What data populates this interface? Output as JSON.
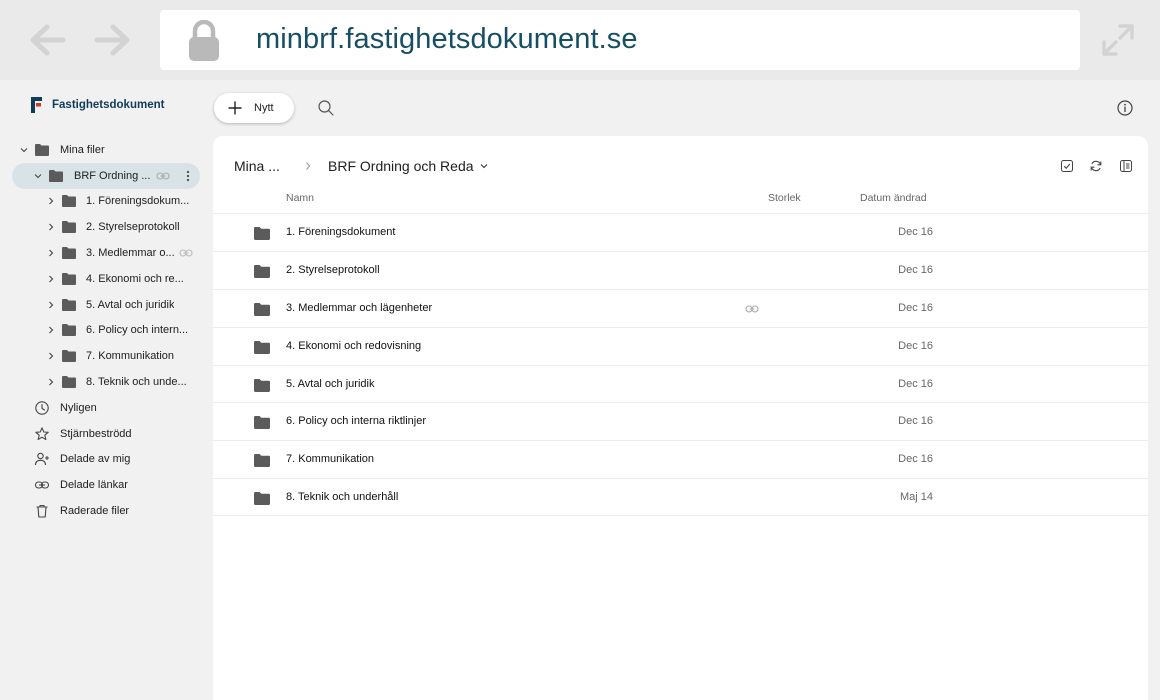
{
  "browser": {
    "url": "minbrf.fastighetsdokument.se"
  },
  "brand": {
    "name": "Fastighetsdokument",
    "accent": "#0f3b57",
    "mark_red": "#d9342b"
  },
  "sidebar": {
    "tree": [
      {
        "label": "Mina filer",
        "level": 0,
        "expanded": true
      },
      {
        "label": "BRF Ordning ...",
        "level": 1,
        "expanded": true,
        "selected": true,
        "shared_link": true
      },
      {
        "label": "1. Föreningsdokum...",
        "level": 2
      },
      {
        "label": "2. Styrelseprotokoll",
        "level": 2
      },
      {
        "label": "3. Medlemmar o...",
        "level": 2,
        "shared_link": true
      },
      {
        "label": "4. Ekonomi och re...",
        "level": 2
      },
      {
        "label": "5. Avtal och juridik",
        "level": 2
      },
      {
        "label": "6. Policy och intern...",
        "level": 2
      },
      {
        "label": "7. Kommunikation",
        "level": 2
      },
      {
        "label": "8. Teknik och unde...",
        "level": 2
      }
    ],
    "quick_links": [
      {
        "label": "Nyligen",
        "icon": "clock-icon"
      },
      {
        "label": "Stjärnbeströdd",
        "icon": "star-icon"
      },
      {
        "label": "Delade av mig",
        "icon": "person-add-icon"
      },
      {
        "label": "Delade länkar",
        "icon": "link-icon"
      },
      {
        "label": "Raderade filer",
        "icon": "trash-icon"
      }
    ]
  },
  "toolbar": {
    "new_label": "Nytt"
  },
  "main": {
    "breadcrumb_root": "Mina ...",
    "breadcrumb_current": "BRF Ordning och Reda",
    "columns": {
      "name": "Namn",
      "size": "Storlek",
      "modified": "Datum ändrad"
    },
    "files": [
      {
        "name": "1. Föreningsdokument",
        "modified": "Dec 16",
        "shared_link": false
      },
      {
        "name": "2. Styrelseprotokoll",
        "modified": "Dec 16",
        "shared_link": false
      },
      {
        "name": "3. Medlemmar och lägenheter",
        "modified": "Dec 16",
        "shared_link": true
      },
      {
        "name": "4. Ekonomi och redovisning",
        "modified": "Dec 16",
        "shared_link": false
      },
      {
        "name": "5. Avtal och juridik",
        "modified": "Dec 16",
        "shared_link": false
      },
      {
        "name": "6. Policy och interna riktlinjer",
        "modified": "Dec 16",
        "shared_link": false
      },
      {
        "name": "7. Kommunikation",
        "modified": "Dec 16",
        "shared_link": false
      },
      {
        "name": "8. Teknik och underhåll",
        "modified": "Maj 14",
        "shared_link": false
      }
    ]
  }
}
